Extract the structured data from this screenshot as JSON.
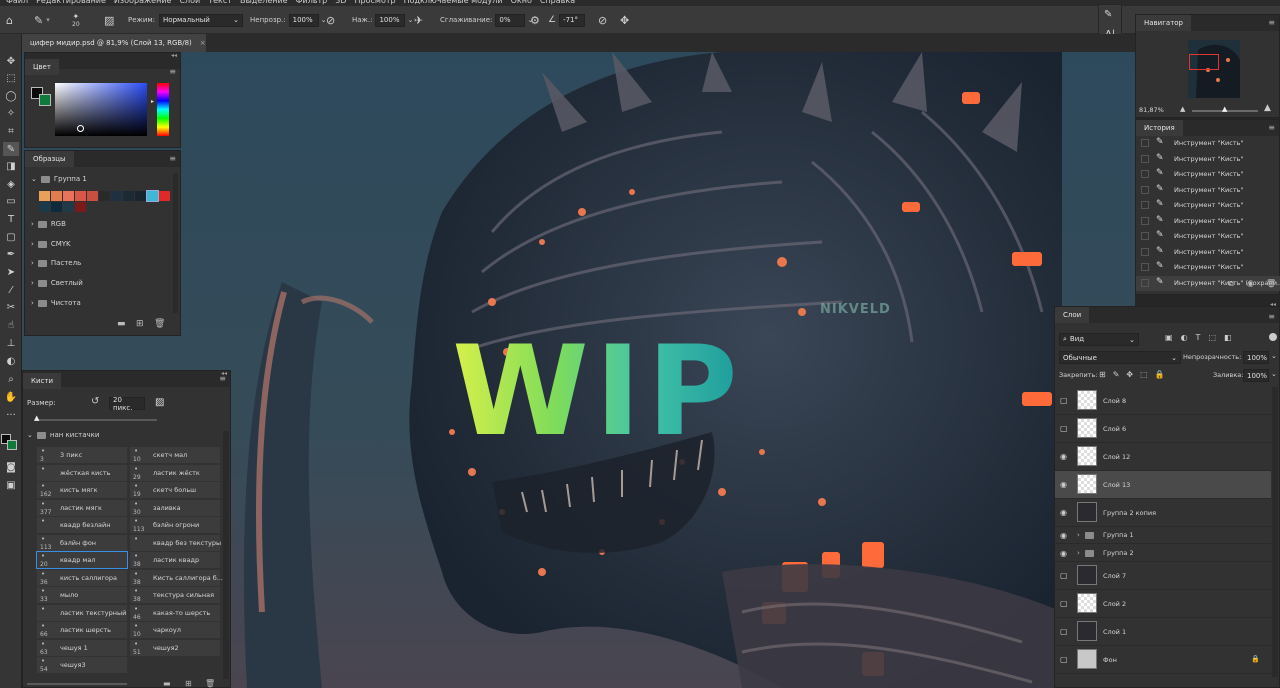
{
  "menu": [
    "Файл",
    "Редактирование",
    "Изображение",
    "Слои",
    "Текст",
    "Выделение",
    "Фильтр",
    "3D",
    "Просмотр",
    "Подключаемые модули",
    "Окно",
    "Справка"
  ],
  "options": {
    "brush_size": "20",
    "mode_label": "Режим:",
    "mode_value": "Нормальный",
    "opacity_label": "Непрозр.:",
    "opacity_value": "100%",
    "pressure_label": "Наж.:",
    "pressure_value": "100%",
    "smoothing_label": "Сглаживание:",
    "smoothing_value": "0%",
    "angle_value": "-71°"
  },
  "document": {
    "tab_title": "цифер мидир.psd @ 81,9% (Слой 13, RGB/8)",
    "close": "×"
  },
  "canvas": {
    "overlay_text": "WIP",
    "watermark": "NIKVELD"
  },
  "color_panel": {
    "title": "Цвет",
    "fg": "#0a0a0a",
    "bg": "#0f7a3c"
  },
  "swatches_panel": {
    "title": "Образцы",
    "groups": [
      "Группа 1",
      "RGB",
      "CMYK",
      "Пастель",
      "Светлый",
      "Чистота"
    ],
    "colors": [
      "#e8a05a",
      "#e27d4f",
      "#e8735a",
      "#d9574a",
      "#c95040",
      "#2a2a2a",
      "#1f3040",
      "#1c2a36",
      "#18252f",
      "#3fb8d8",
      "#e02a2a",
      "#1a3a4a",
      "#0f2a3a",
      "#223a48",
      "#7a1a1a"
    ]
  },
  "brushes_panel": {
    "title": "Кисти",
    "size_label": "Размер:",
    "size_value": "20 пикс.",
    "group": "нан кистачки",
    "brushes": [
      {
        "num": "3",
        "name": "3 пикс"
      },
      {
        "num": "10",
        "name": "скетч мал"
      },
      {
        "num": "",
        "name": "жёсткая кисть"
      },
      {
        "num": "29",
        "name": "ластик жёстк"
      },
      {
        "num": "162",
        "name": "кисть мягк"
      },
      {
        "num": "19",
        "name": "скетч больш"
      },
      {
        "num": "377",
        "name": "ластик мягк"
      },
      {
        "num": "30",
        "name": "заливка"
      },
      {
        "num": "",
        "name": "квадр безлайн"
      },
      {
        "num": "113",
        "name": "бэлйн огрони"
      },
      {
        "num": "113",
        "name": "бэлйн фон"
      },
      {
        "num": "",
        "name": "квадр без текстуры"
      },
      {
        "num": "20",
        "name": "квадр мал"
      },
      {
        "num": "38",
        "name": "ластик квадр"
      },
      {
        "num": "36",
        "name": "кисть саллигора"
      },
      {
        "num": "38",
        "name": "Кисть саллигора б..."
      },
      {
        "num": "33",
        "name": "мыло"
      },
      {
        "num": "38",
        "name": "текстура сильная"
      },
      {
        "num": "",
        "name": "ластик текстурный"
      },
      {
        "num": "46",
        "name": "какая-то шерсть"
      },
      {
        "num": "66",
        "name": "ластик шерсть"
      },
      {
        "num": "10",
        "name": "чаркоул"
      },
      {
        "num": "63",
        "name": "чешуя 1"
      },
      {
        "num": "51",
        "name": "чешуя2"
      },
      {
        "num": "54",
        "name": "чешуя3"
      }
    ]
  },
  "navigator": {
    "title": "Навигатор",
    "zoom": "81,87%"
  },
  "history": {
    "title": "История",
    "items": [
      "Инструмент \"Кисть\"",
      "Инструмент \"Кисть\"",
      "Инструмент \"Кисть\"",
      "Инструмент \"Кисть\"",
      "Инструмент \"Кисть\"",
      "Инструмент \"Кисть\"",
      "Инструмент \"Кисть\"",
      "Инструмент \"Кисть\"",
      "Инструмент \"Кисть\"",
      "Инструмент \"Кисть\" (Сохрани..."
    ]
  },
  "layers": {
    "title": "Слои",
    "filter": "Вид",
    "blend": "Обычные",
    "opacity_label": "Непрозрачность:",
    "opacity_value": "100%",
    "lock_label": "Закрепить:",
    "fill_label": "Заливка:",
    "fill_value": "100%",
    "items": [
      {
        "name": "Слой 8",
        "visible": false,
        "group": false
      },
      {
        "name": "Слой 6",
        "visible": false,
        "group": false
      },
      {
        "name": "Слой 12",
        "visible": true,
        "group": false
      },
      {
        "name": "Слой 13",
        "visible": true,
        "group": false,
        "selected": true
      },
      {
        "name": "Группа 2 копия",
        "visible": true,
        "group": false
      },
      {
        "name": "Группа 1",
        "visible": true,
        "group": true
      },
      {
        "name": "Группа 2",
        "visible": true,
        "group": true
      },
      {
        "name": "Слой 7",
        "visible": false,
        "group": false
      },
      {
        "name": "Слой 2",
        "visible": false,
        "group": false
      },
      {
        "name": "Слой 1",
        "visible": false,
        "group": false
      },
      {
        "name": "Фон",
        "visible": false,
        "group": false
      }
    ]
  }
}
